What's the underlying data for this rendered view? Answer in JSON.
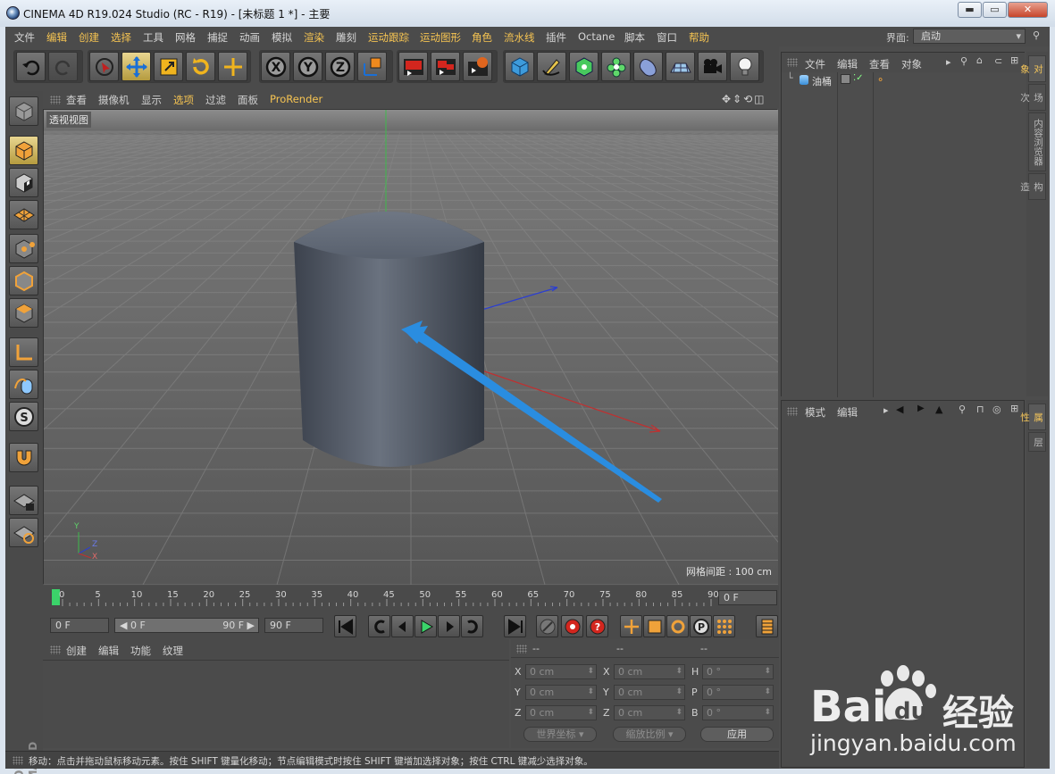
{
  "window": {
    "title": "CINEMA 4D R19.024 Studio (RC - R19) - [未标题 1 *] - 主要",
    "minimize": "▬",
    "maximize": "▭",
    "close": "✕"
  },
  "menubar": {
    "items": [
      "文件",
      "编辑",
      "创建",
      "选择",
      "工具",
      "网格",
      "捕捉",
      "动画",
      "模拟",
      "渲染",
      "雕刻",
      "运动跟踪",
      "运动图形",
      "角色",
      "流水线",
      "插件",
      "Octane",
      "脚本",
      "窗口",
      "帮助"
    ],
    "interface_label": "界面:",
    "interface_value": "启动"
  },
  "toolbar": {
    "icons": [
      "undo-icon",
      "redo-icon",
      "live-selection-icon",
      "move-icon",
      "scale-icon",
      "rotate-icon",
      "add-object-icon",
      "x-axis-icon",
      "y-axis-icon",
      "z-axis-icon",
      "coordinate-system-icon",
      "render-view-icon",
      "render-picture-viewer-icon",
      "edit-render-settings-icon",
      "cube-icon",
      "pen-icon",
      "subdivision-icon",
      "cloner-icon",
      "deformer-icon",
      "floor-icon",
      "camera-icon",
      "light-icon"
    ]
  },
  "viewport": {
    "menu": [
      "查看",
      "摄像机",
      "显示",
      "选项",
      "过滤",
      "面板",
      "ProRender"
    ],
    "view_name": "透视视图",
    "grid_spacing": "网格间距 : 100 cm",
    "axis_labels": {
      "y": "Y",
      "z": "Z",
      "x": "X"
    }
  },
  "timeline": {
    "ticks": [
      "0",
      "5",
      "10",
      "15",
      "20",
      "25",
      "30",
      "35",
      "40",
      "45",
      "50",
      "55",
      "60",
      "65",
      "70",
      "75",
      "80",
      "85",
      "90"
    ],
    "current_frame": "0 F"
  },
  "transport": {
    "start_field": "0 F",
    "range_start": "◀ 0 F",
    "range_end": "90 F ▶",
    "end_field": "90 F"
  },
  "materials": {
    "menu": [
      "创建",
      "编辑",
      "功能",
      "纹理"
    ]
  },
  "coordinates": {
    "headers": [
      "--",
      "--",
      "--"
    ],
    "rows": [
      {
        "l1": "X",
        "v1": "0 cm",
        "l2": "X",
        "v2": "0 cm",
        "l3": "H",
        "v3": "0 °"
      },
      {
        "l1": "Y",
        "v1": "0 cm",
        "l2": "Y",
        "v2": "0 cm",
        "l3": "P",
        "v3": "0 °"
      },
      {
        "l1": "Z",
        "v1": "0 cm",
        "l2": "Z",
        "v2": "0 cm",
        "l3": "B",
        "v3": "0 °"
      }
    ],
    "world_coords": "世界坐标",
    "scale_ratio": "缩放比例",
    "apply": "应用"
  },
  "object_manager": {
    "menu": [
      "文件",
      "编辑",
      "查看",
      "对象"
    ],
    "objects": [
      {
        "name": "油桶"
      }
    ]
  },
  "attribute_manager": {
    "menu": [
      "模式",
      "编辑"
    ]
  },
  "side_tabs_top": [
    "对象",
    "场次",
    "内容浏览器",
    "构造"
  ],
  "side_tabs_bottom": [
    "属性",
    "层"
  ],
  "status": "移动：点击并拖动鼠标移动元素。按住 SHIFT 键量化移动；节点编辑模式时按住 SHIFT 键增加选择对象；按住 CTRL 键减少选择对象。",
  "watermark": {
    "brand": "Bai",
    "brand2": "du",
    "cn": "经验",
    "url": "jingyan.baidu.com"
  },
  "colors": {
    "accent": "#f6c452",
    "arrow": "#2a8de0"
  }
}
